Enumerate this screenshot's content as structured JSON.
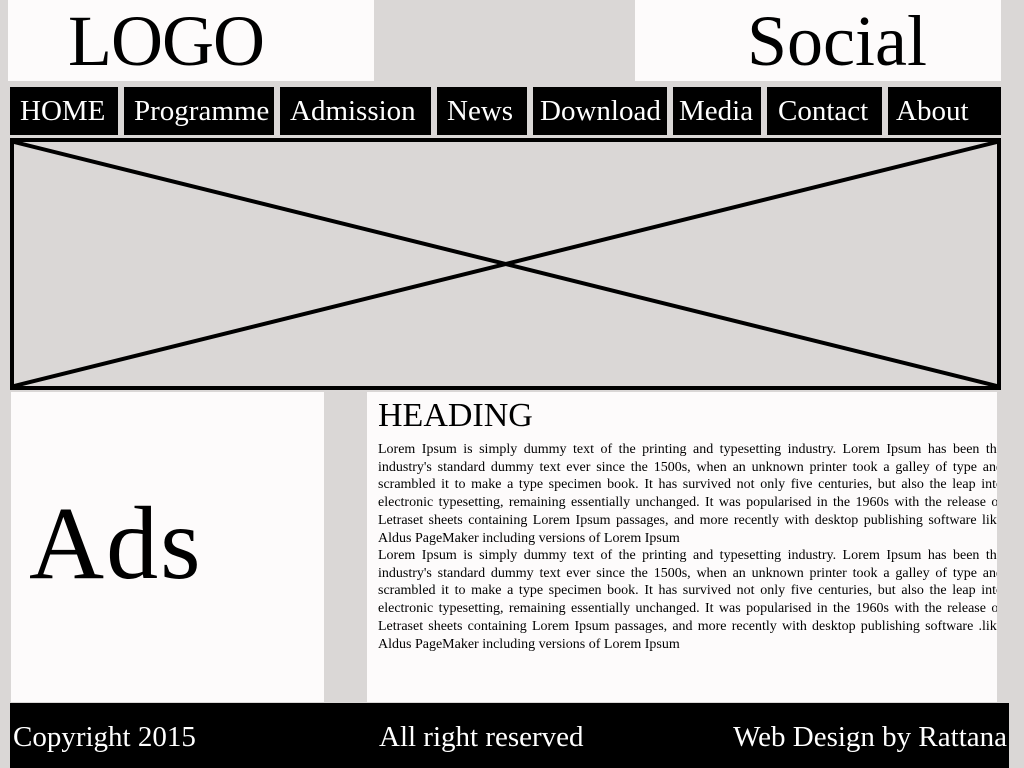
{
  "header": {
    "logo": "LOGO",
    "social": "Social"
  },
  "nav": {
    "items": [
      "HOME",
      "Programme",
      "Admission",
      "News",
      "Download",
      "Media",
      "Contact",
      "About"
    ]
  },
  "banner": {
    "placeholder_icon": "image-placeholder-cross"
  },
  "ads": {
    "label": "Ads"
  },
  "content": {
    "heading": "HEADING",
    "paragraphs": [
      "Lorem Ipsum is simply dummy text of the printing and typesetting industry. Lorem Ipsum has been the industry's standard dummy text ever since the 1500s, when an unknown printer took a galley of type and scrambled it to make a type specimen book. It has survived not only five centuries, but also the leap into electronic typesetting, remaining essentially unchanged. It was popularised in the 1960s with the release of Letraset sheets containing Lorem Ipsum passages, and more recently with desktop publishing software like Aldus PageMaker including versions of Lorem Ipsum",
      "Lorem Ipsum is simply dummy text of the printing and typesetting industry. Lorem Ipsum has been the industry's standard dummy text ever since the 1500s, when an unknown printer took a galley of type and scrambled it to make a type specimen book. It has survived not only five centuries, but also the leap into electronic typesetting, remaining essentially unchanged. It was popularised in the 1960s with the release of Letraset sheets containing Lorem Ipsum passages, and more recently with desktop publishing software .like Aldus PageMaker including versions of Lorem Ipsum"
    ]
  },
  "footer": {
    "copyright": "Copyright 2015",
    "rights": "All right reserved",
    "credit": "Web Design by Rattana"
  },
  "colors": {
    "page_background": "#dad7d6",
    "box_background": "#fdfbfb",
    "bar_background": "#000000",
    "bar_text": "#ffffff"
  }
}
